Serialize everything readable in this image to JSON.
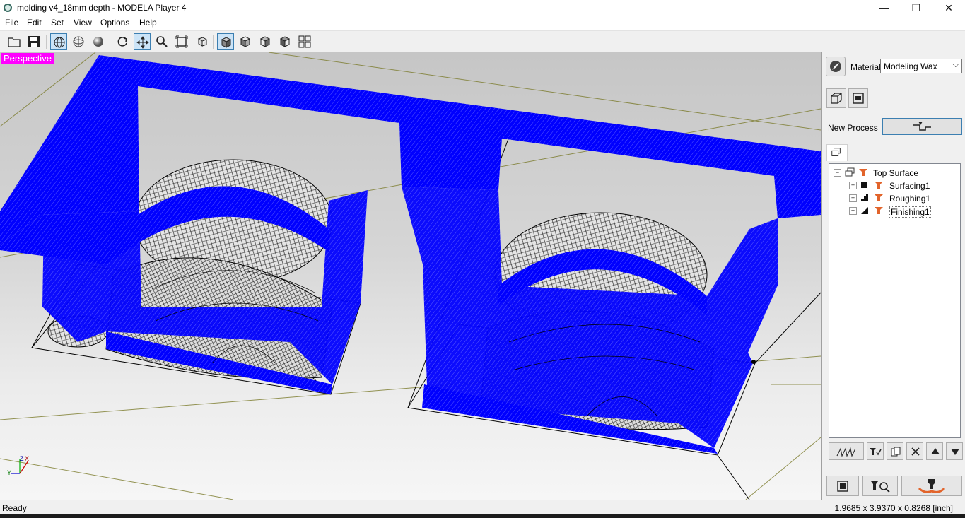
{
  "window": {
    "title": "molding v4_18mm depth  - MODELA Player 4",
    "minimize_glyph": "—",
    "maximize_glyph": "❐",
    "close_glyph": "✕"
  },
  "menu": [
    "File",
    "Edit",
    "Set",
    "View",
    "Options",
    "Help"
  ],
  "toolbar": {
    "buttons": [
      {
        "name": "open-icon"
      },
      {
        "name": "save-icon"
      },
      {
        "name": "wireframe-view-icon",
        "selected": true
      },
      {
        "name": "wireframe-sphere-icon"
      },
      {
        "name": "shaded-sphere-icon"
      },
      {
        "name": "rotate-icon"
      },
      {
        "name": "move-icon",
        "selected": true
      },
      {
        "name": "zoom-icon"
      },
      {
        "name": "fit-to-window-icon"
      },
      {
        "name": "zoom-box-icon"
      },
      {
        "name": "perspective-view-icon",
        "selected": true
      },
      {
        "name": "front-view-icon"
      },
      {
        "name": "right-view-icon"
      },
      {
        "name": "left-view-icon"
      },
      {
        "name": "four-views-icon"
      }
    ]
  },
  "viewport": {
    "view_label": "Perspective",
    "axis_labels": {
      "z": "Z",
      "x": "X",
      "y": "Y"
    }
  },
  "right_panel": {
    "material_label": "Material",
    "material_value": "Modeling Wax",
    "new_process_label": "New Process",
    "tree": [
      {
        "label": "Top Surface",
        "level": 0,
        "icon": "surface-icon"
      },
      {
        "label": "Surfacing1",
        "level": 1,
        "icon": "surfacing-icon"
      },
      {
        "label": "Roughing1",
        "level": 1,
        "icon": "roughing-icon"
      },
      {
        "label": "Finishing1",
        "level": 1,
        "icon": "finishing-icon"
      }
    ]
  },
  "status": {
    "left": "Ready",
    "right": "1.9685 x 3.9370 x 0.8268 [inch]"
  },
  "colors": {
    "toolpath": "#0000ff",
    "view_label_bg": "#ff00ff",
    "accent": "#e2642b"
  }
}
